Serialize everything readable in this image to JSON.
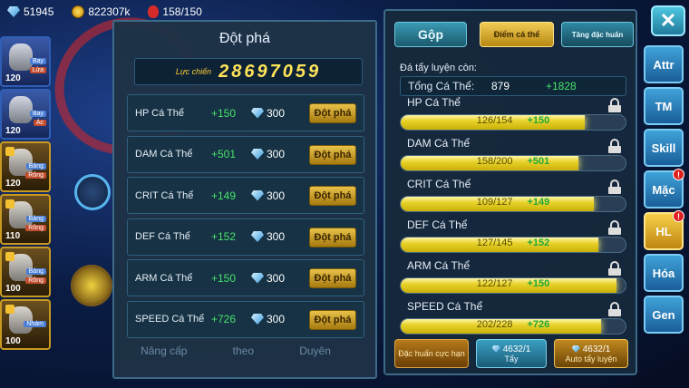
{
  "topbar": {
    "gems": "51945",
    "gold": "822307k",
    "energy": "158/150"
  },
  "characters": [
    {
      "level": "120",
      "tag1": "Bay",
      "tag2": "Lửa",
      "locked": false
    },
    {
      "level": "120",
      "tag1": "Bay",
      "tag2": "Ác",
      "locked": false
    },
    {
      "level": "120",
      "tag1": "Bảng",
      "tag2": "Rồng",
      "locked": true
    },
    {
      "level": "110",
      "tag1": "Bảng",
      "tag2": "Rồng",
      "locked": true
    },
    {
      "level": "100",
      "tag1": "Bảng",
      "tag2": "Rồng",
      "locked": true
    },
    {
      "level": "100",
      "tag1": "Nhám",
      "tag2": "",
      "locked": true
    }
  ],
  "popup": {
    "title": "Đột phá",
    "power_label": "Lực chiến",
    "power_value": "28697059",
    "button_label": "Đột phá",
    "stats": [
      {
        "name": "HP Cá Thể",
        "plus": "+150",
        "cost": "300"
      },
      {
        "name": "DAM Cá Thể",
        "plus": "+501",
        "cost": "300"
      },
      {
        "name": "CRIT Cá Thể",
        "plus": "+149",
        "cost": "300"
      },
      {
        "name": "DEF Cá Thể",
        "plus": "+152",
        "cost": "300"
      },
      {
        "name": "ARM Cá Thể",
        "plus": "+150",
        "cost": "300"
      },
      {
        "name": "SPEED Cá Thể",
        "plus": "+726",
        "cost": "300"
      }
    ]
  },
  "bottom_tabs": [
    "Nâng cấp",
    "theo",
    "Duyên"
  ],
  "right_panel": {
    "tabs": {
      "gop": "Gộp",
      "diem": "Điểm cá thể",
      "tang": "Tăng đặc huấn"
    },
    "remaining_label": "Đá tẩy luyện còn:",
    "total": {
      "name": "Tổng Cá Thể:",
      "value": "879",
      "plus": "+1828"
    },
    "bars": [
      {
        "name": "HP Cá Thể",
        "current": 126,
        "max": 154,
        "text": "126/154",
        "plus": "+150"
      },
      {
        "name": "DAM Cá Thể",
        "current": 158,
        "max": 200,
        "text": "158/200",
        "plus": "+501"
      },
      {
        "name": "CRIT Cá Thể",
        "current": 109,
        "max": 127,
        "text": "109/127",
        "plus": "+149"
      },
      {
        "name": "DEF Cá Thể",
        "current": 127,
        "max": 145,
        "text": "127/145",
        "plus": "+152"
      },
      {
        "name": "ARM Cá Thể",
        "current": 122,
        "max": 127,
        "text": "122/127",
        "plus": "+150"
      },
      {
        "name": "SPEED Cá Thể",
        "current": 202,
        "max": 228,
        "text": "202/228",
        "plus": "+726"
      }
    ],
    "bottom": {
      "btn1": "Đặc huấn cực hạn",
      "btn2_count": "4632/1",
      "btn2_label": "Tẩy",
      "btn3_count": "4632/1",
      "btn3_label": "Auto tẩy luyện"
    }
  },
  "sidebar": [
    {
      "label": "Attr",
      "badge": "",
      "active": false
    },
    {
      "label": "TM",
      "badge": "",
      "active": false
    },
    {
      "label": "Skill",
      "badge": "",
      "active": false
    },
    {
      "label": "Mặc",
      "badge": "!",
      "active": false
    },
    {
      "label": "HL",
      "badge": "!",
      "active": true
    },
    {
      "label": "Hóa",
      "badge": "",
      "active": false
    },
    {
      "label": "Gen",
      "badge": "",
      "active": false
    }
  ],
  "close_label": "✕"
}
